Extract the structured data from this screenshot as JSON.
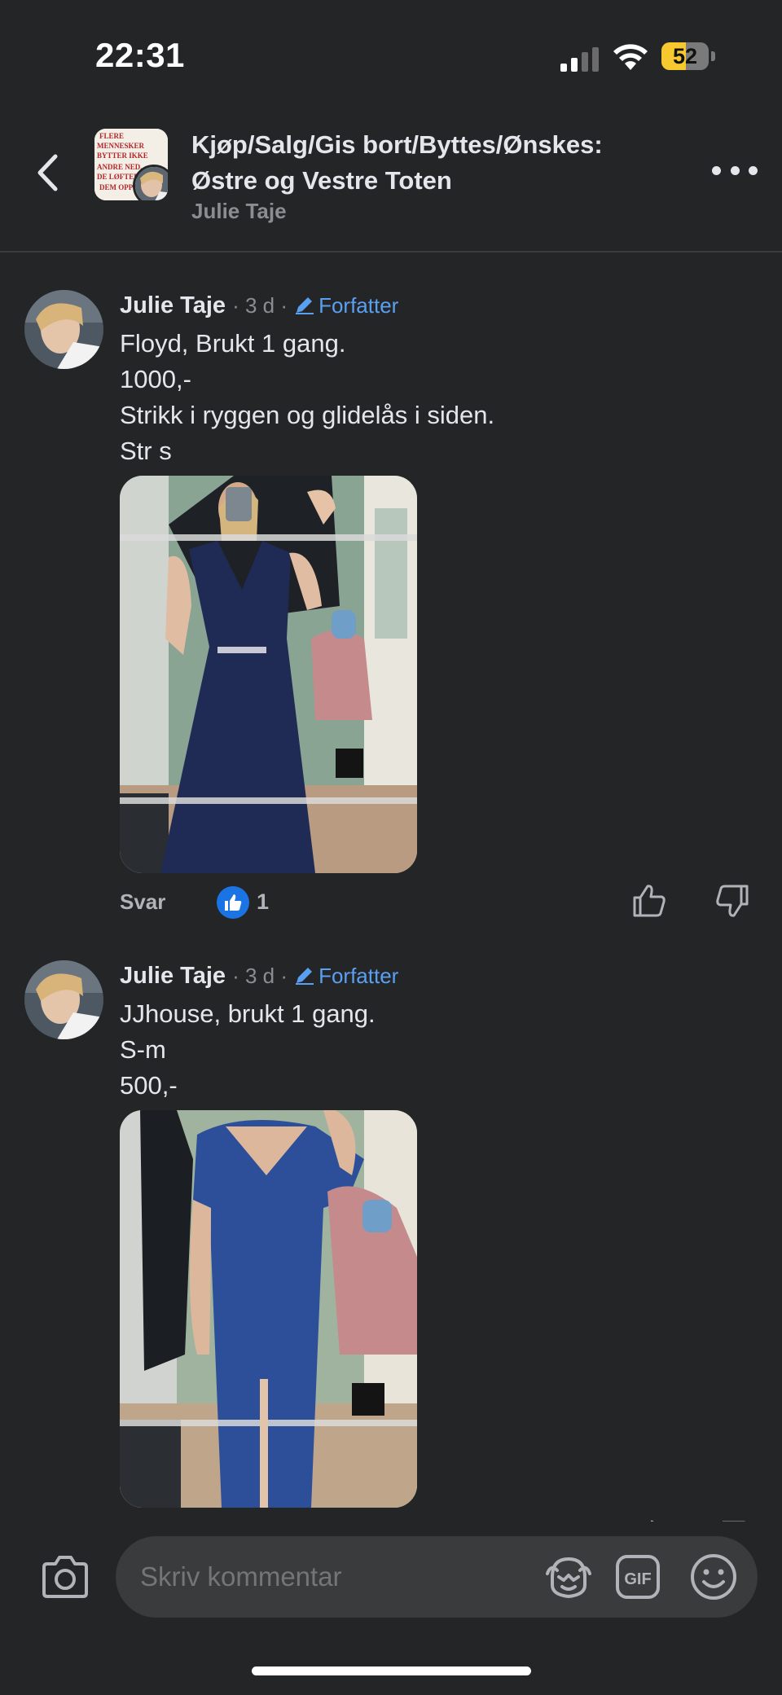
{
  "status_bar": {
    "time": "22:31",
    "battery": "52",
    "battery_level": 0.52,
    "icons": [
      "signal-icon",
      "wifi-icon",
      "battery-icon"
    ]
  },
  "header": {
    "title_line1": "Kjøp/Salg/Gis bort/Byttes/Ønskes:",
    "title_line2": "Østre og Vestre Toten",
    "subtitle": "Julie Taje",
    "avatar_text": [
      "FLERE",
      "MENNESKER",
      "BYTTER IKKE",
      "ANDRE NED,",
      "DE LØFTER",
      "DEM OPP!"
    ]
  },
  "comments": [
    {
      "author": "Julie Taje",
      "meta": "· 3 d ·",
      "badge": "Forfatter",
      "lines": [
        "Floyd, Brukt 1 gang.",
        "1000,-",
        "Strikk i ryggen og glidelås i siden.",
        "Str s"
      ],
      "reply_label": "Svar",
      "likes": "1"
    },
    {
      "author": "Julie Taje",
      "meta": "· 3 d ·",
      "badge": "Forfatter",
      "lines": [
        "JJhouse, brukt 1 gang.",
        "S-m",
        "500,-"
      ]
    }
  ],
  "composer": {
    "placeholder": "Skriv kommentar",
    "gif_label": "GIF"
  },
  "colors": {
    "background": "#242526",
    "accent": "#1b74e4",
    "author_badge": "#5aa0f2",
    "battery": "#f7c92e"
  }
}
